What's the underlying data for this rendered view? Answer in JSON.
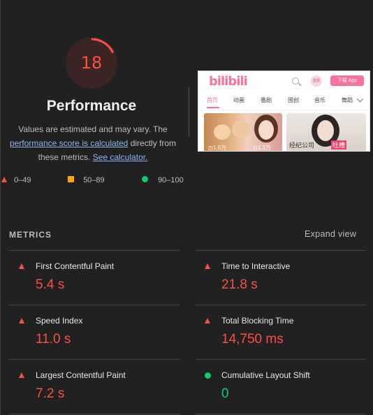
{
  "gauge": {
    "score": "18",
    "score_fraction": 0.18,
    "color": "#ff4e42",
    "bg_color": "#3a2424"
  },
  "performance": {
    "title": "Performance",
    "desc_prefix": "Values are estimated and may vary. The",
    "desc_link1": "performance score is calculated",
    "desc_middle": " directly from",
    "desc_line3": "these metrics.",
    "desc_link2": "See calculator."
  },
  "thumbnail": {
    "logo": "bilibili",
    "avatar_text": "登录",
    "app_button": "下载 App",
    "nav": [
      "首页",
      "动画",
      "番剧",
      "国创",
      "音乐",
      "舞蹈"
    ],
    "active_nav": "首页",
    "card1_caption": "◷1.6万",
    "card1_caption2": "⊡1.3万",
    "card2_caption": "经纪公司",
    "card2_tag": "吐槽"
  },
  "legend": [
    {
      "icon": "fail-triangle-icon",
      "label": "0–49",
      "color": "#ff4e42"
    },
    {
      "icon": "average-square-icon",
      "label": "50–89",
      "color": "#ffa400"
    },
    {
      "icon": "pass-circle-icon",
      "label": "90–100",
      "color": "#0cce6b"
    }
  ],
  "metrics": {
    "label": "METRICS",
    "expand": "Expand view",
    "items": [
      {
        "title": "First Contentful Paint",
        "value": "5.4 s",
        "status": "fail"
      },
      {
        "title": "Time to Interactive",
        "value": "21.8 s",
        "status": "fail"
      },
      {
        "title": "Speed Index",
        "value": "11.0 s",
        "status": "fail"
      },
      {
        "title": "Total Blocking Time",
        "value": "14,750 ms",
        "status": "fail"
      },
      {
        "title": "Largest Contentful Paint",
        "value": "7.2 s",
        "status": "fail"
      },
      {
        "title": "Cumulative Layout Shift",
        "value": "0",
        "status": "pass"
      }
    ]
  },
  "colors": {
    "fail": "#ff4e42",
    "average": "#ffa400",
    "pass": "#0cce6b",
    "link": "#8ab4f8",
    "background": "#212121"
  }
}
